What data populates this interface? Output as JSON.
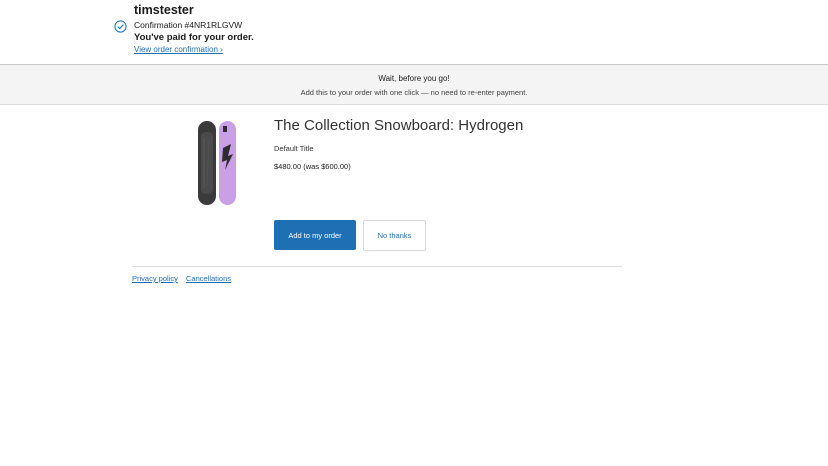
{
  "header": {
    "shop_name": "timstester",
    "confirmation": "Confirmation #4NR1RLGVW",
    "paid_message": "You've paid for your order.",
    "view_link": "View order confirmation ›"
  },
  "banner": {
    "title": "Wait, before you go!",
    "subtitle": "Add this to your order with one click — no need to re-enter payment."
  },
  "product": {
    "title": "The Collection Snowboard: Hydrogen",
    "variant": "Default Title",
    "price": "$480.00 (was $600.00)"
  },
  "actions": {
    "add_label": "Add to my order",
    "decline_label": "No thanks"
  },
  "footer": {
    "links": [
      "Privacy policy",
      "Cancellations"
    ]
  },
  "colors": {
    "accent": "#1f6fb5",
    "banner_bg": "#f4f4f4",
    "board_dark": "#3a3a3a",
    "board_purple": "#c9a0e6"
  }
}
